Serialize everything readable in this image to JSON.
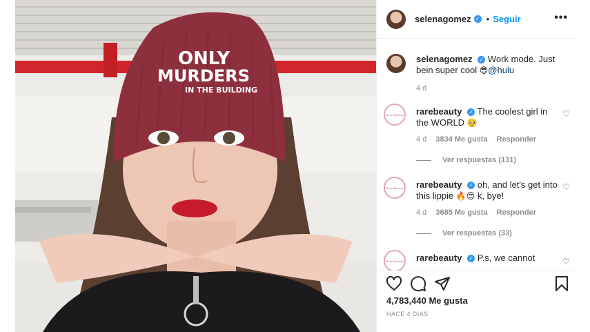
{
  "post": {
    "author": "selenagomez",
    "follow_label": "Seguir",
    "separator": "•",
    "more_label": "•••",
    "hat_text_line1": "ONLY",
    "hat_text_line2": "MURDERS",
    "hat_text_line3": "IN THE BUILDING"
  },
  "caption": {
    "author": "selenagomez",
    "text": "Work mode. Just bein super cool ",
    "emoji": "😎",
    "mention": "@hulu",
    "time": "4 d"
  },
  "comments": [
    {
      "author": "rarebeauty",
      "avatar_text": "Rare Beauty",
      "text": "The coolest girl in the WORLD ",
      "emoji": "🥺",
      "time": "4 d",
      "likes": "3834 Me gusta",
      "reply_label": "Responder",
      "view_replies": "Ver respuestas (131)"
    },
    {
      "author": "rarebeauty",
      "avatar_text": "Rare Beauty",
      "text": "oh, and let's get into this lippie ",
      "emoji": "🔥😍",
      "text_after": " k, bye!",
      "time": "4 d",
      "likes": "3685 Me gusta",
      "reply_label": "Responder",
      "view_replies": "Ver respuestas (33)"
    },
    {
      "author": "rarebeauty",
      "avatar_text": "Rare Beauty",
      "text": "P.s, we cannot"
    }
  ],
  "footer": {
    "likes": "4,783,440 Me gusta",
    "ago": "HACE 4 DÍAS"
  },
  "icons": {
    "like": "heart-icon",
    "comment": "comment-icon",
    "share": "share-icon",
    "save": "bookmark-icon",
    "verified": "verified-badge-icon"
  },
  "colors": {
    "follow_blue": "#0095f6",
    "verified_blue": "#3897f0",
    "beanie": "#8e2f3e"
  }
}
